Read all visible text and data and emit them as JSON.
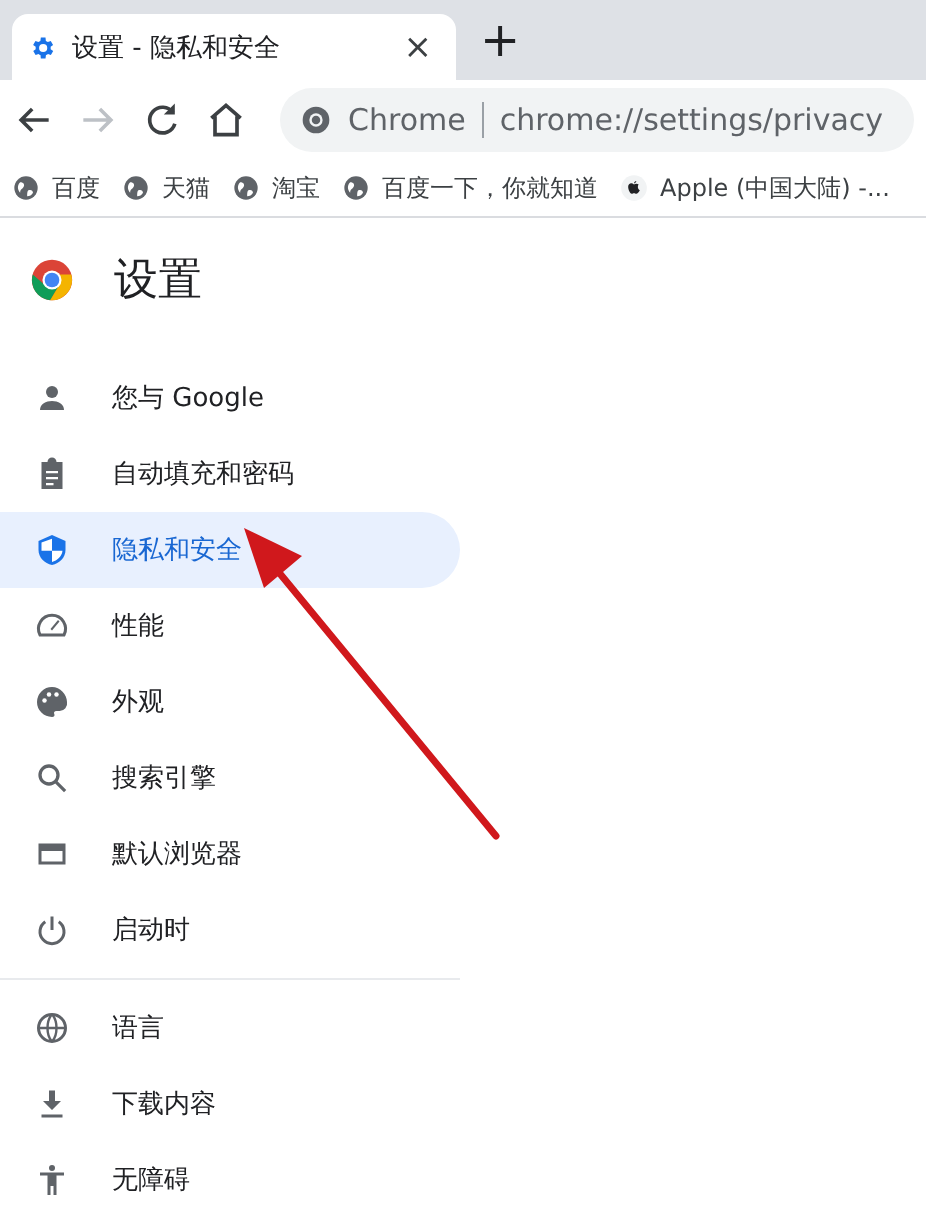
{
  "tab": {
    "title": "设置 - 隐私和安全",
    "close": "×"
  },
  "new_tab": "+",
  "address_bar": {
    "site": "Chrome",
    "url": "chrome://settings/privacy"
  },
  "bookmarks": [
    {
      "kind": "globe",
      "label": "百度"
    },
    {
      "kind": "globe",
      "label": "天猫"
    },
    {
      "kind": "globe",
      "label": "淘宝"
    },
    {
      "kind": "globe",
      "label": "百度一下，你就知道"
    },
    {
      "kind": "apple",
      "label": "Apple (中国大陆) -..."
    }
  ],
  "page_title": "设置",
  "sidebar": {
    "sections": [
      {
        "items": [
          {
            "label": "您与 Google",
            "selected": false
          },
          {
            "label": "自动填充和密码",
            "selected": false
          },
          {
            "label": "隐私和安全",
            "selected": true
          },
          {
            "label": "性能",
            "selected": false
          },
          {
            "label": "外观",
            "selected": false
          },
          {
            "label": "搜索引擎",
            "selected": false
          },
          {
            "label": "默认浏览器",
            "selected": false
          },
          {
            "label": "启动时",
            "selected": false
          }
        ]
      },
      {
        "items": [
          {
            "label": "语言",
            "selected": false
          },
          {
            "label": "下载内容",
            "selected": false
          },
          {
            "label": "无障碍",
            "selected": false
          }
        ]
      }
    ]
  }
}
